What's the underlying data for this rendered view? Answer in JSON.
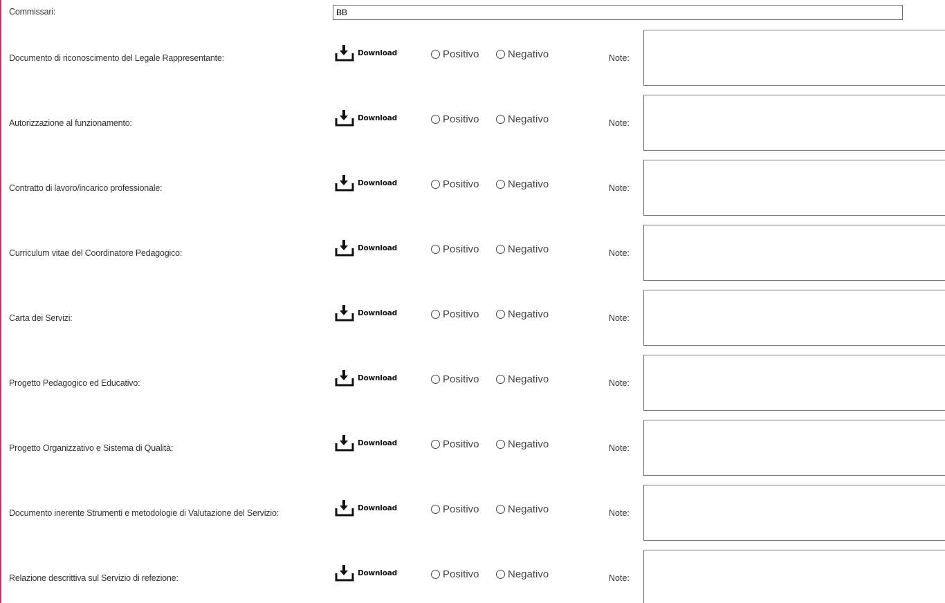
{
  "commissari": {
    "label": "Commissari:",
    "value": "BB"
  },
  "common": {
    "download_label": "Download",
    "positivo_label": "Positivo",
    "negativo_label": "Negativo",
    "note_label": "Note:"
  },
  "documents": [
    {
      "label": "Documento di riconoscimento del Legale Rappresentante:",
      "note": ""
    },
    {
      "label": "Autorizzazione al funzionamento:",
      "note": ""
    },
    {
      "label": "Contratto di lavoro/incarico professionale:",
      "note": ""
    },
    {
      "label": "Curriculum vitae del Coordinatore Pedagogico:",
      "note": ""
    },
    {
      "label": "Carta dei Servizi:",
      "note": ""
    },
    {
      "label": "Progetto Pedagogico ed Educativo:",
      "note": ""
    },
    {
      "label": "Progetto Organizzativo e Sistema di Qualità:",
      "note": ""
    },
    {
      "label": "Documento inerente Strumenti e metodologie di Valutazione del Servizio:",
      "note": ""
    },
    {
      "label": "Relazione descrittiva sul Servizio di refezione:",
      "note": ""
    }
  ],
  "icons": {
    "download": "download-icon",
    "radio": "radio-icon"
  },
  "colors": {
    "left_border": "#b03a6a",
    "text": "#333333",
    "input_border": "#6b6b6b"
  }
}
